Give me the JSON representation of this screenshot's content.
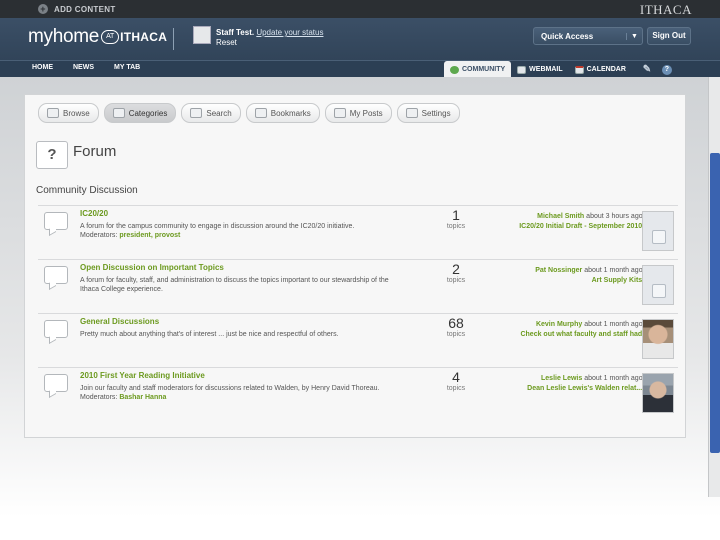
{
  "topbar": {
    "add_content": "ADD CONTENT",
    "brand": "ITHACA"
  },
  "header": {
    "logo_my": "myhome",
    "logo_at": "AT",
    "logo_ithaca": "ITHACA",
    "user_name": "Staff Test.",
    "status_link": "Update your status",
    "status_extra": "Reset",
    "quick_access": "Quick Access",
    "sign_out": "Sign Out"
  },
  "nav": {
    "left": [
      "HOME",
      "NEWS",
      "MY TAB"
    ],
    "community": "COMMUNITY",
    "webmail": "WEBMAIL",
    "calendar": "CALENDAR"
  },
  "toolbar": [
    "Browse",
    "Categories",
    "Search",
    "Bookmarks",
    "My Posts",
    "Settings"
  ],
  "forum": {
    "title": "Forum",
    "icon_glyph": "?",
    "section": "Community Discussion",
    "rows": [
      {
        "title": "IC20/20",
        "desc": "A forum for the campus community to engage in discussion around the IC20/20 initiative.",
        "mod_label": "Moderators:",
        "mods": "president, provost",
        "count": "1",
        "unit": "topics",
        "author": "Michael Smith",
        "when": "about 3 hours ago in",
        "post": "IC20/20 Initial Draft - September 2010",
        "thumb": "blank"
      },
      {
        "title": "Open Discussion on Important Topics",
        "desc": "A forum for faculty, staff, and administration to discuss the topics important to our stewardship of the Ithaca College experience.",
        "mod_label": "",
        "mods": "",
        "count": "2",
        "unit": "topics",
        "author": "Pat Nossinger",
        "when": "about 1 month ago in",
        "post": "Art Supply Kits",
        "thumb": "blank"
      },
      {
        "title": "General Discussions",
        "desc": "Pretty much about anything that's of interest ... just be nice and respectful of others.",
        "mod_label": "",
        "mods": "",
        "count": "68",
        "unit": "topics",
        "author": "Kevin Murphy",
        "when": "about 1 month ago in",
        "post": "Check out what faculty and staff had ...",
        "thumb": "photo1"
      },
      {
        "title": "2010 First Year Reading Initiative",
        "desc": "Join our faculty and staff moderators for discussions related to Walden, by Henry David Thoreau.",
        "mod_label": "Moderators:",
        "mods": "Bashar Hanna",
        "count": "4",
        "unit": "topics",
        "author": "Leslie Lewis",
        "when": "about 1 month ago in",
        "post": "Dean Leslie Lewis's Walden relat...",
        "thumb": "photo2"
      }
    ]
  }
}
